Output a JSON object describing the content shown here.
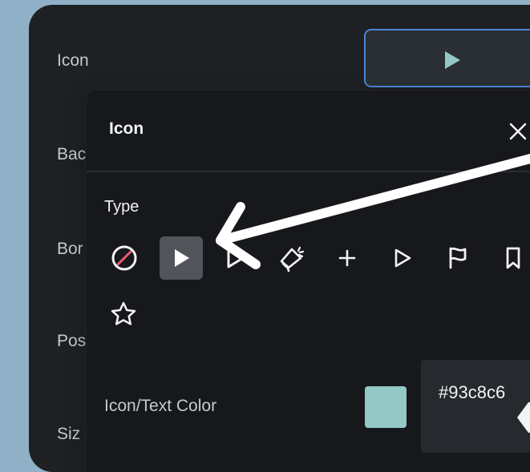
{
  "settings": {
    "labels": {
      "icon": "Icon",
      "background": "Bac",
      "border": "Bor",
      "position": "Pos",
      "size": "Siz"
    }
  },
  "popover": {
    "title": "Icon",
    "type_label": "Type",
    "icon_options": [
      {
        "name": "none-icon"
      },
      {
        "name": "play-filled-icon"
      },
      {
        "name": "forward-icon"
      },
      {
        "name": "megaphone-icon"
      },
      {
        "name": "plus-icon"
      },
      {
        "name": "play-outline-icon"
      },
      {
        "name": "flag-icon"
      },
      {
        "name": "bookmark-icon"
      },
      {
        "name": "star-icon"
      }
    ],
    "color_label": "Icon/Text Color",
    "color_value": "#93c8c6",
    "hex_display": "#93c8c6"
  },
  "colors": {
    "outer_background": "#8fb0c6",
    "panel_background": "#1e2023",
    "popover_background": "#17181b",
    "accent_blue": "#4a86d8",
    "teal": "#93c8c6",
    "forbidden_red": "#ef5a73"
  }
}
